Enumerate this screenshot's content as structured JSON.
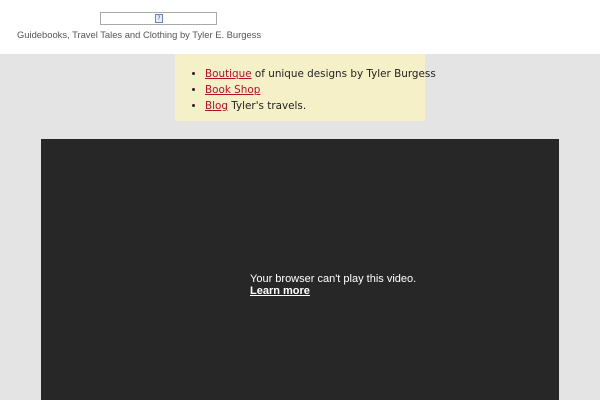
{
  "header": {
    "logo_icon": "broken-image-icon",
    "logo_icon_glyph": "?",
    "tagline": "Guidebooks, Travel Tales and Clothing by Tyler E. Burgess"
  },
  "links": [
    {
      "link": "Boutique",
      "text": " of unique designs by Tyler Burgess"
    },
    {
      "link": "Book Shop",
      "text": ""
    },
    {
      "link": "Blog",
      "text": " Tyler's travels."
    }
  ],
  "video": {
    "message": "Your browser can't play this video.",
    "learn_more": "Learn more"
  },
  "colors": {
    "link": "#b0102a",
    "box_bg": "#f6f0c8",
    "page_bg": "#e4e4e4",
    "video_bg": "#272727"
  }
}
